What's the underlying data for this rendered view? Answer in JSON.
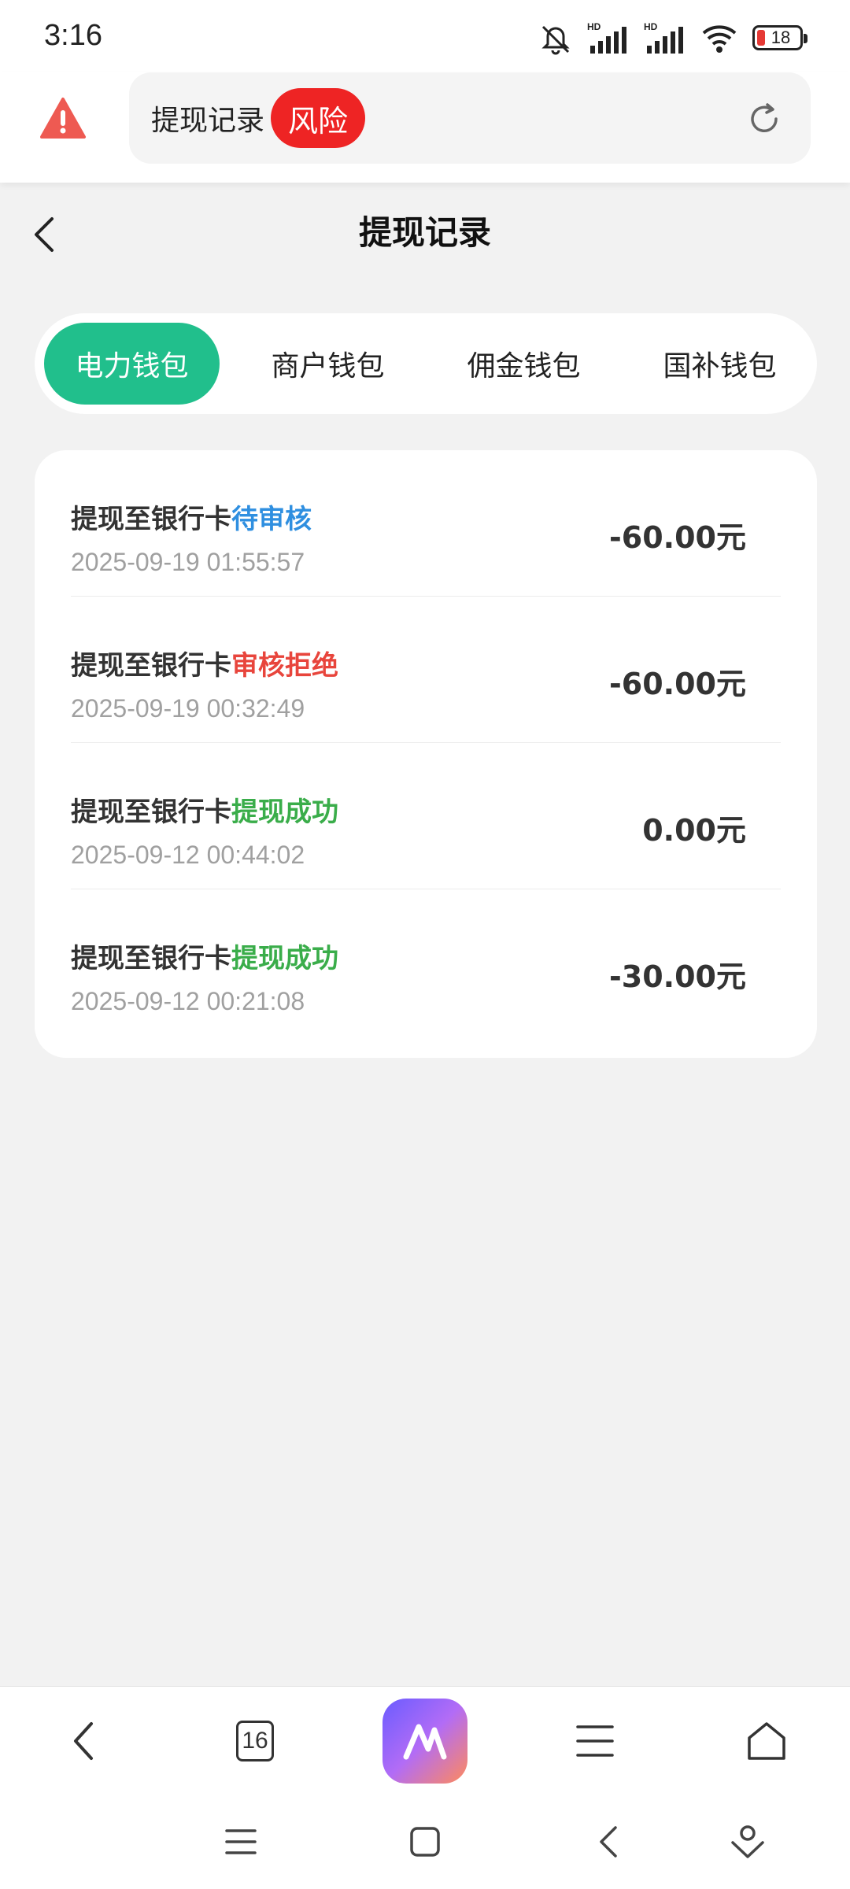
{
  "status_bar": {
    "time": "3:16",
    "battery": "18"
  },
  "browser": {
    "url_text": "提现记录",
    "risk_label": "风险",
    "tab_count": "16"
  },
  "page": {
    "title": "提现记录"
  },
  "tabs": [
    {
      "label": "电力钱包",
      "active": true
    },
    {
      "label": "商户钱包",
      "active": false
    },
    {
      "label": "佣金钱包",
      "active": false
    },
    {
      "label": "国补钱包",
      "active": false
    }
  ],
  "records": [
    {
      "title": "提现至银行卡",
      "status": "待审核",
      "status_color": "#2f8fe0",
      "time": "2025-09-19 01:55:57",
      "amount": "-60.00元"
    },
    {
      "title": "提现至银行卡",
      "status": "审核拒绝",
      "status_color": "#e8453c",
      "time": "2025-09-19 00:32:49",
      "amount": "-60.00元"
    },
    {
      "title": "提现至银行卡",
      "status": "提现成功",
      "status_color": "#3aad4a",
      "time": "2025-09-12 00:44:02",
      "amount": "0.00元"
    },
    {
      "title": "提现至银行卡",
      "status": "提现成功",
      "status_color": "#3aad4a",
      "time": "2025-09-12 00:21:08",
      "amount": "-30.00元"
    }
  ],
  "colors": {
    "accent": "#21bf8c",
    "risk": "#ee2424",
    "warning": "#ee5a52"
  }
}
